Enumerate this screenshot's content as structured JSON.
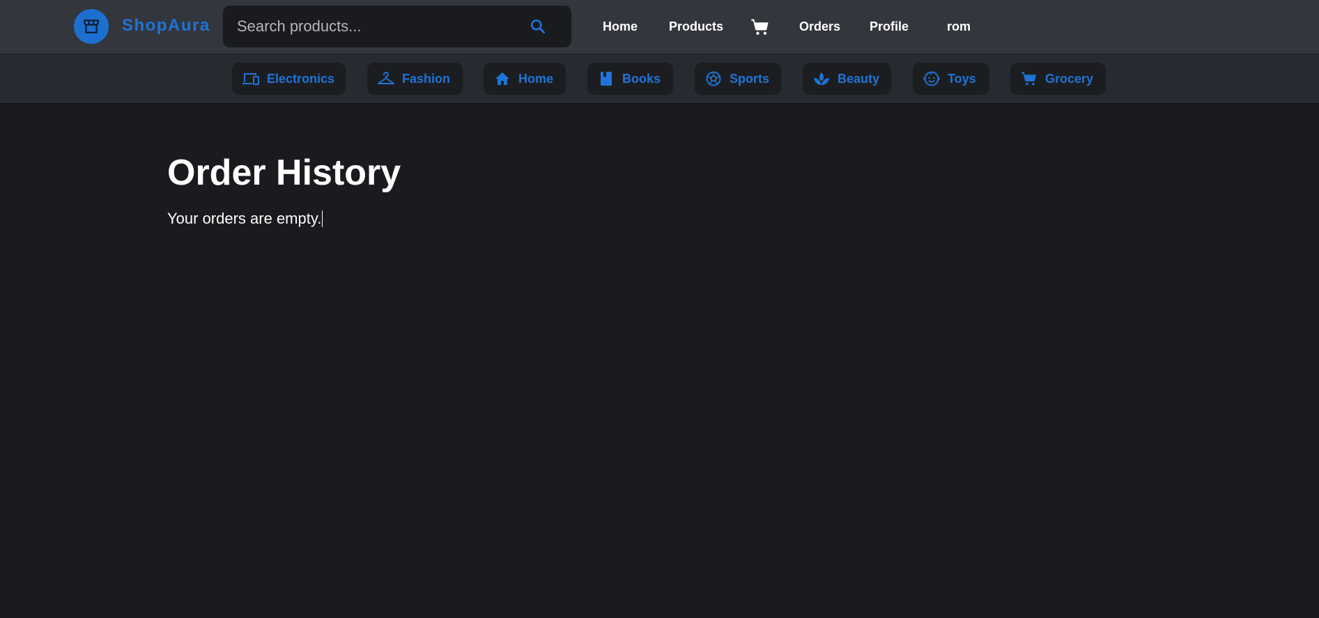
{
  "colors": {
    "accent": "#1f74d6",
    "header_bg": "#34363d",
    "category_bar_bg": "#262a31",
    "page_bg": "#1a1b1e",
    "pill_bg": "#1c1d21"
  },
  "header": {
    "logo_icon": "storefront-icon",
    "brand": "ShopAura",
    "search": {
      "placeholder": "Search products...",
      "value": "",
      "icon": "search-icon"
    },
    "nav": {
      "home": "Home",
      "products": "Products",
      "cart_icon": "cart-icon",
      "orders": "Orders",
      "profile": "Profile",
      "user": "rom"
    }
  },
  "categories": [
    {
      "label": "Electronics",
      "icon": "devices-icon"
    },
    {
      "label": "Fashion",
      "icon": "hanger-icon"
    },
    {
      "label": "Home",
      "icon": "house-icon"
    },
    {
      "label": "Books",
      "icon": "book-icon"
    },
    {
      "label": "Sports",
      "icon": "soccer-ball-icon"
    },
    {
      "label": "Beauty",
      "icon": "spa-icon"
    },
    {
      "label": "Toys",
      "icon": "child-face-icon"
    },
    {
      "label": "Grocery",
      "icon": "cart-icon"
    }
  ],
  "main": {
    "title": "Order History",
    "empty_message": "Your orders are empty."
  }
}
